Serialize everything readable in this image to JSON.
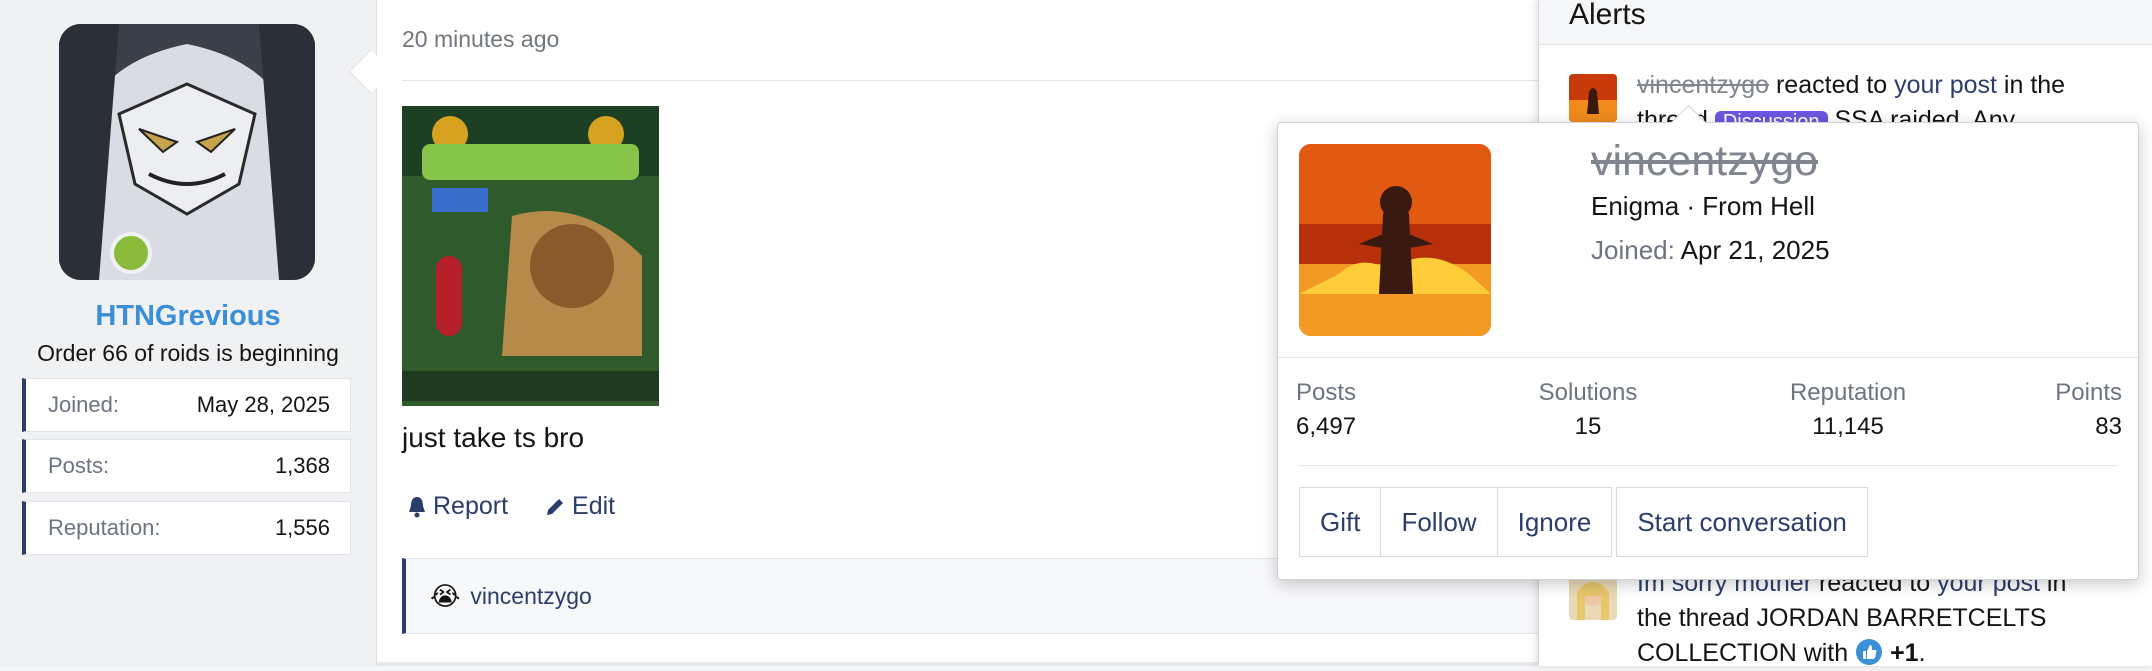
{
  "colors": {
    "accent": "#3b8fd6",
    "link": "#2b3e6b",
    "online": "#8bbb3a",
    "tag": "#6c57e0"
  },
  "user": {
    "username": "HTNGrevious",
    "title": "Order 66 of roids is beginning",
    "stats": [
      {
        "label": "Joined:",
        "value": "May 28, 2025"
      },
      {
        "label": "Posts:",
        "value": "1,368"
      },
      {
        "label": "Reputation:",
        "value": "1,556"
      }
    ]
  },
  "post": {
    "time": "20 minutes ago",
    "text": "just take ts bro",
    "actions": {
      "report": "Report",
      "edit": "Edit"
    },
    "image_icon": "supplement-box-image",
    "reaction": {
      "emoji": "😭",
      "user": "vincentzygo"
    }
  },
  "alerts": {
    "title": "Alerts",
    "items": [
      {
        "user": "vincentzygo",
        "action": "reacted to",
        "target": "your post",
        "suffix": "in the",
        "line2": "thread",
        "tag": "Discussion",
        "thread": "SSA raided. Any"
      },
      {
        "user": "Im sorry mother",
        "action": "reacted to",
        "target": "your post",
        "suffix": "in",
        "line2": "the thread JORDAN BARRETCELTS",
        "line3_prefix": "COLLECTION with",
        "reaction": "+1",
        "end": "."
      }
    ]
  },
  "member_card": {
    "name": "vincentzygo",
    "title": "Enigma",
    "location": "· From Hell",
    "joined_label": "Joined:",
    "joined_value": "Apr 21, 2025",
    "stats": {
      "posts": {
        "label": "Posts",
        "value": "6,497"
      },
      "solutions": {
        "label": "Solutions",
        "value": "15"
      },
      "reputation": {
        "label": "Reputation",
        "value": "11,145"
      },
      "points": {
        "label": "Points",
        "value": "83"
      }
    },
    "buttons": {
      "gift": "Gift",
      "follow": "Follow",
      "ignore": "Ignore",
      "start": "Start conversation"
    }
  }
}
